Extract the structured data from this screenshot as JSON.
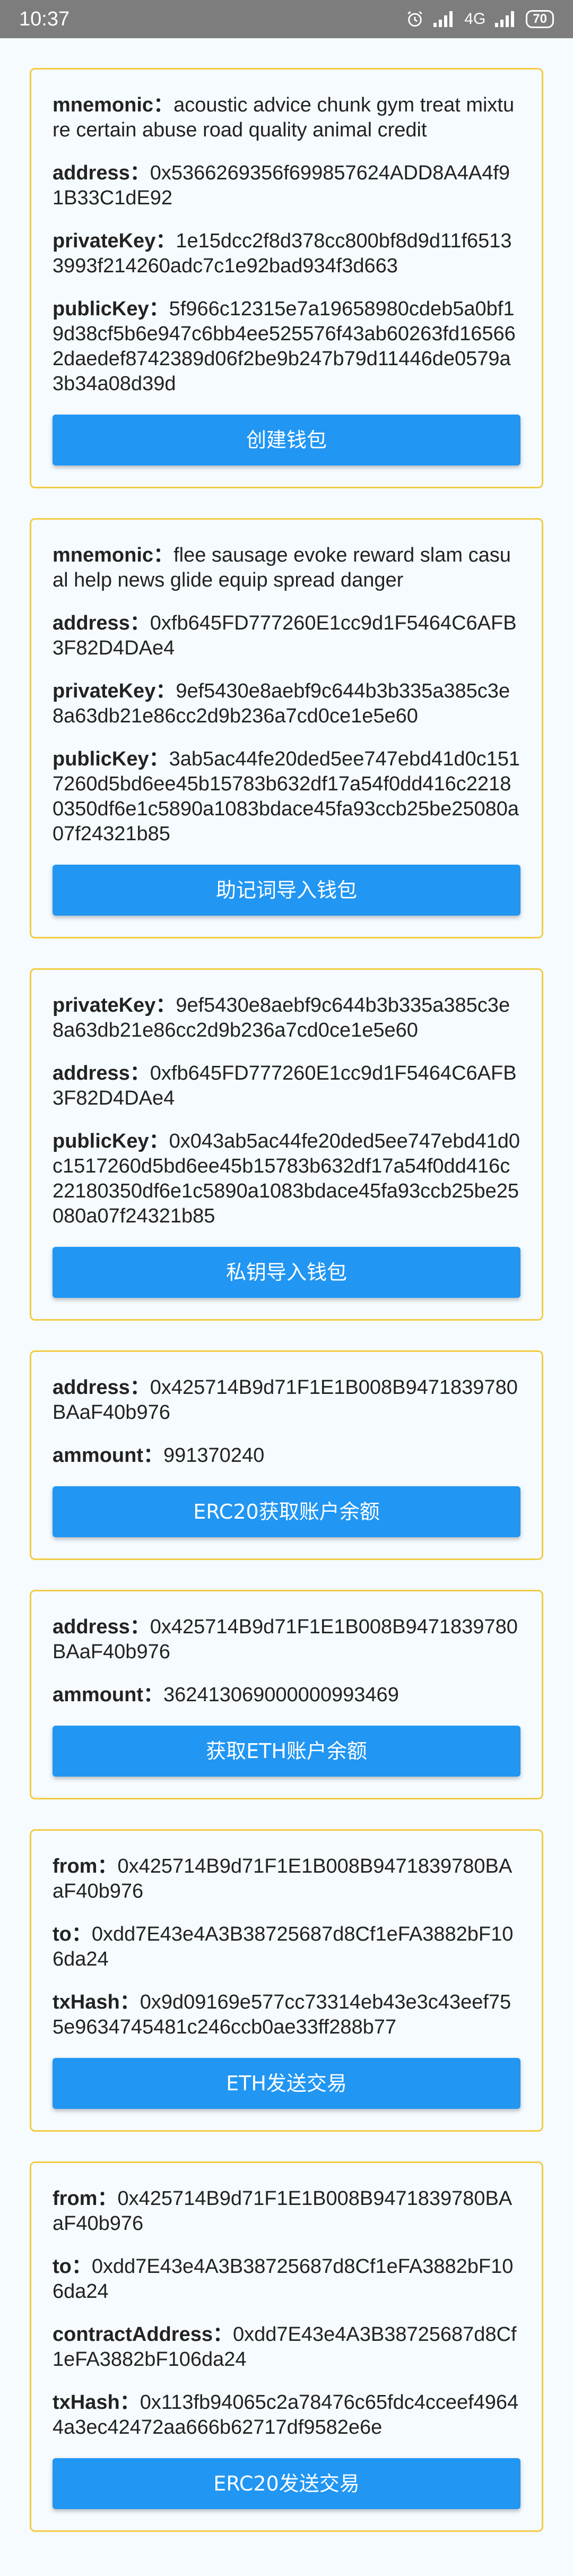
{
  "status_bar": {
    "time": "10:37",
    "network": "4G",
    "battery": "70"
  },
  "colors": {
    "card_border": "#f3cc45",
    "button": "#2196f3",
    "status_bar": "#7d7d7d"
  },
  "cards": [
    {
      "fields": [
        {
          "key": "mnemonic",
          "value": "acoustic advice chunk gym treat mixture certain abuse road quality animal credit"
        },
        {
          "key": "address",
          "value": "0x5366269356f699857624ADD8A4A4f91B33C1dE92"
        },
        {
          "key": "privateKey",
          "value": "1e15dcc2f8d378cc800bf8d9d11f65133993f214260adc7c1e92bad934f3d663"
        },
        {
          "key": "publicKey",
          "value": "5f966c12315e7a19658980cdeb5a0bf19d38cf5b6e947c6bb4ee525576f43ab60263fd165662daedef8742389d06f2be9b247b79d11446de0579a3b34a08d39d"
        }
      ],
      "button": "创建钱包"
    },
    {
      "fields": [
        {
          "key": "mnemonic",
          "value": "flee sausage evoke reward slam casual help news glide equip spread danger"
        },
        {
          "key": "address",
          "value": "0xfb645FD777260E1cc9d1F5464C6AFB3F82D4DAe4"
        },
        {
          "key": "privateKey",
          "value": "9ef5430e8aebf9c644b3b335a385c3e8a63db21e86cc2d9b236a7cd0ce1e5e60"
        },
        {
          "key": "publicKey",
          "value": "3ab5ac44fe20ded5ee747ebd41d0c1517260d5bd6ee45b15783b632df17a54f0dd416c22180350df6e1c5890a1083bdace45fa93ccb25be25080a07f24321b85"
        }
      ],
      "button": "助记词导入钱包"
    },
    {
      "fields": [
        {
          "key": "privateKey",
          "value": "9ef5430e8aebf9c644b3b335a385c3e8a63db21e86cc2d9b236a7cd0ce1e5e60"
        },
        {
          "key": "address",
          "value": "0xfb645FD777260E1cc9d1F5464C6AFB3F82D4DAe4"
        },
        {
          "key": "publicKey",
          "value": "0x043ab5ac44fe20ded5ee747ebd41d0c1517260d5bd6ee45b15783b632df17a54f0dd416c22180350df6e1c5890a1083bdace45fa93ccb25be25080a07f24321b85"
        }
      ],
      "button": "私钥导入钱包"
    },
    {
      "fields": [
        {
          "key": "address",
          "value": "0x425714B9d71F1E1B008B9471839780BAaF40b976"
        },
        {
          "key": "ammount",
          "value": "991370240"
        }
      ],
      "button": "ERC20获取账户余额"
    },
    {
      "fields": [
        {
          "key": "address",
          "value": "0x425714B9d71F1E1B008B9471839780BAaF40b976"
        },
        {
          "key": "ammount",
          "value": "362413069000000993469"
        }
      ],
      "button": "获取ETH账户余额"
    },
    {
      "fields": [
        {
          "key": "from",
          "value": "0x425714B9d71F1E1B008B9471839780BAaF40b976"
        },
        {
          "key": "to",
          "value": "0xdd7E43e4A3B38725687d8Cf1eFA3882bF106da24"
        },
        {
          "key": "txHash",
          "value": "0x9d09169e577cc73314eb43e3c43eef755e9634745481c246ccb0ae33ff288b77"
        }
      ],
      "button": "ETH发送交易"
    },
    {
      "fields": [
        {
          "key": "from",
          "value": "0x425714B9d71F1E1B008B9471839780BAaF40b976"
        },
        {
          "key": "to",
          "value": "0xdd7E43e4A3B38725687d8Cf1eFA3882bF106da24"
        },
        {
          "key": "contractAddress",
          "value": "0xdd7E43e4A3B38725687d8Cf1eFA3882bF106da24"
        },
        {
          "key": "txHash",
          "value": "0x113fb94065c2a78476c65fdc4cceef49644a3ec42472aa666b62717df9582e6e"
        }
      ],
      "button": "ERC20发送交易"
    }
  ]
}
